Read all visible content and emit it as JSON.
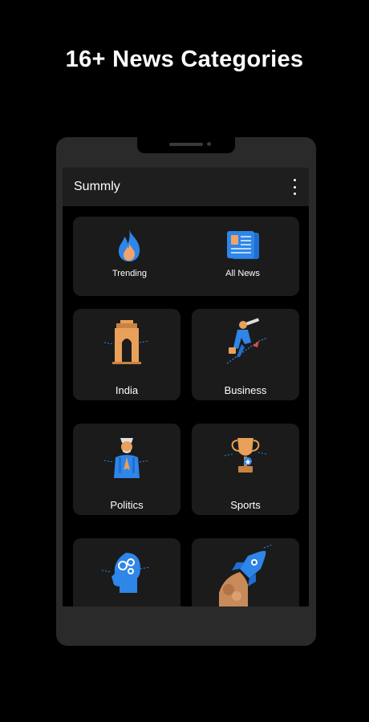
{
  "headline": "16+ News Categories",
  "app": {
    "title": "Summly"
  },
  "featured": [
    {
      "label": "Trending",
      "icon": "flame-icon"
    },
    {
      "label": "All News",
      "icon": "newspaper-icon"
    }
  ],
  "categories": [
    {
      "label": "India",
      "icon": "india-gate-icon"
    },
    {
      "label": "Business",
      "icon": "businessman-telescope-icon"
    },
    {
      "label": "Politics",
      "icon": "politician-icon"
    },
    {
      "label": "Sports",
      "icon": "trophy-icon"
    },
    {
      "label": "",
      "icon": "brain-gears-icon"
    },
    {
      "label": "",
      "icon": "rocket-icon"
    }
  ],
  "colors": {
    "background": "#000000",
    "phone_frame": "#2a2a2a",
    "card": "#1b1b1b",
    "accent_blue": "#2e86e8",
    "accent_orange": "#e8a05a"
  }
}
